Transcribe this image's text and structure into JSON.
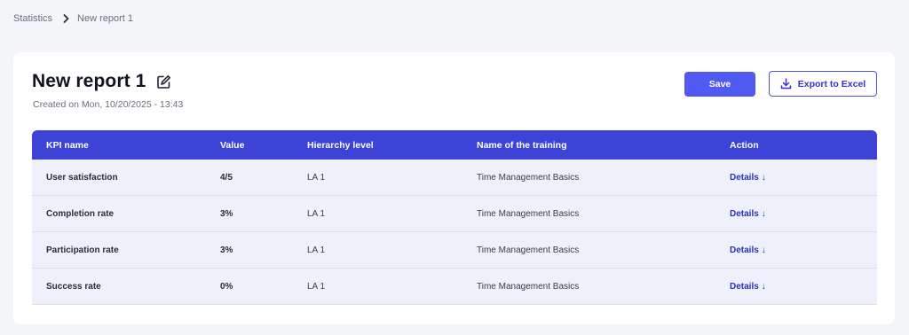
{
  "breadcrumb": {
    "parent": "Statistics",
    "current": "New report 1"
  },
  "report": {
    "title": "New report 1",
    "created": "Created on Mon, 10/20/2025 - 13:43"
  },
  "actions": {
    "save_label": "Save",
    "export_label": "Export to Excel"
  },
  "table": {
    "headers": [
      "KPI name",
      "Value",
      "Hierarchy level",
      "Name of the training",
      "Action"
    ],
    "rows": [
      {
        "kpi": "User satisfaction",
        "value": "4/5",
        "level": "LA 1",
        "training": "Time Management Basics",
        "action": "Details",
        "action_icon": "↓"
      },
      {
        "kpi": "Completion rate",
        "value": "3%",
        "level": "LA 1",
        "training": "Time Management Basics",
        "action": "Details",
        "action_icon": "↓"
      },
      {
        "kpi": "Participation rate",
        "value": "3%",
        "level": "LA 1",
        "training": "Time Management Basics",
        "action": "Details",
        "action_icon": "↓"
      },
      {
        "kpi": "Success rate",
        "value": "0%",
        "level": "LA 1",
        "training": "Time Management Basics",
        "action": "Details",
        "action_icon": "↓"
      }
    ]
  },
  "icons": {
    "breadcrumb_separator": "chevron-right-icon",
    "edit": "pencil-square-icon",
    "export": "download-icon"
  },
  "colors": {
    "accent": "#5159f3",
    "table_header": "#3c43d6",
    "row_background": "#eef0fb",
    "link": "#2a31b8"
  }
}
